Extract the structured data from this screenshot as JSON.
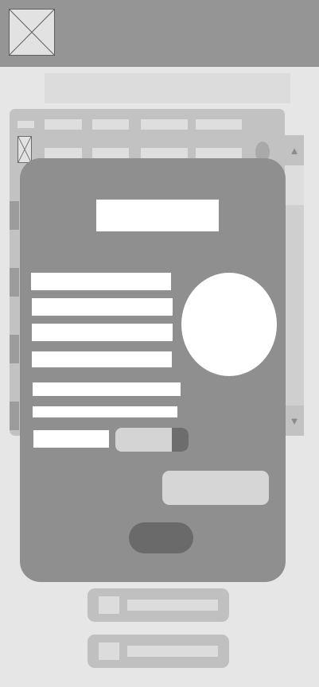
{
  "header": {
    "logo_icon": "image-placeholder-icon"
  },
  "search": {
    "placeholder": ""
  },
  "table": {
    "columns": [
      "",
      "",
      "",
      "",
      ""
    ],
    "rows": [
      {
        "thumb_icon": "image-placeholder-icon",
        "cells": [
          "",
          "",
          "",
          ""
        ],
        "status_icon": "circle-icon"
      }
    ]
  },
  "scrollbar": {
    "up_glyph": "▲",
    "down_glyph": "▼"
  },
  "modal": {
    "title": "",
    "fields": [
      "",
      "",
      "",
      ""
    ],
    "avatar_icon": "avatar-circle",
    "text_lines": [
      "",
      ""
    ],
    "small_input": "",
    "toggle_on": true,
    "secondary_button": "",
    "primary_button": ""
  },
  "list": [
    {
      "icon": "square-icon",
      "label": ""
    },
    {
      "icon": "square-icon",
      "label": ""
    }
  ]
}
